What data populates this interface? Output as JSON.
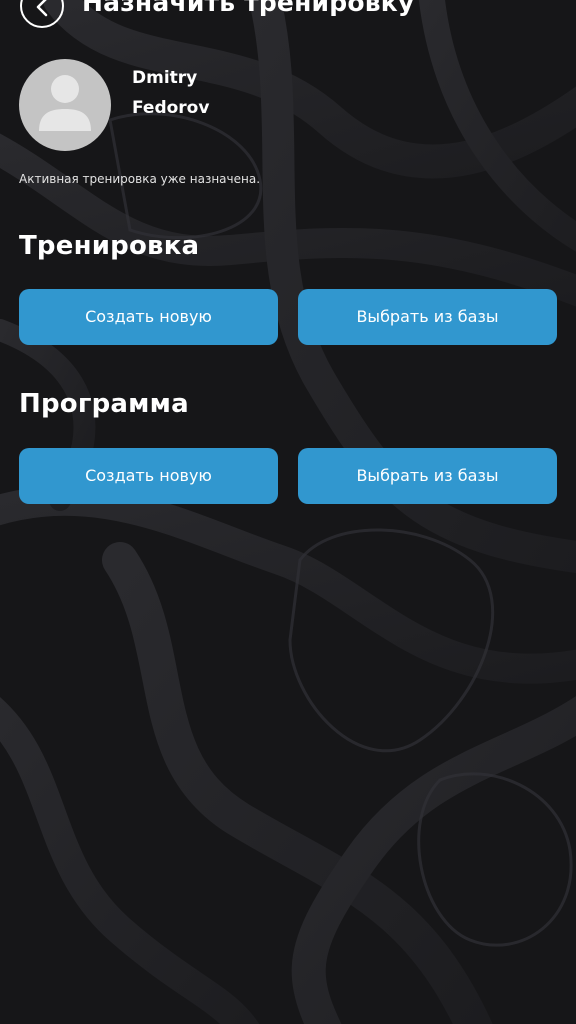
{
  "header": {
    "title": "Назначить тренировку",
    "back_icon": "chevron-left-icon"
  },
  "profile": {
    "first_name": "Dmitry",
    "last_name": "Fedorov",
    "avatar_icon": "user-placeholder-icon"
  },
  "status": {
    "message": "Активная тренировка уже назначена."
  },
  "sections": {
    "workout": {
      "title": "Тренировка",
      "create_label": "Создать новую",
      "choose_label": "Выбрать из базы"
    },
    "program": {
      "title": "Программа",
      "create_label": "Создать новую",
      "choose_label": "Выбрать из базы"
    }
  },
  "colors": {
    "accent": "#3197cf",
    "background": "#17171a",
    "text": "#ffffff"
  }
}
